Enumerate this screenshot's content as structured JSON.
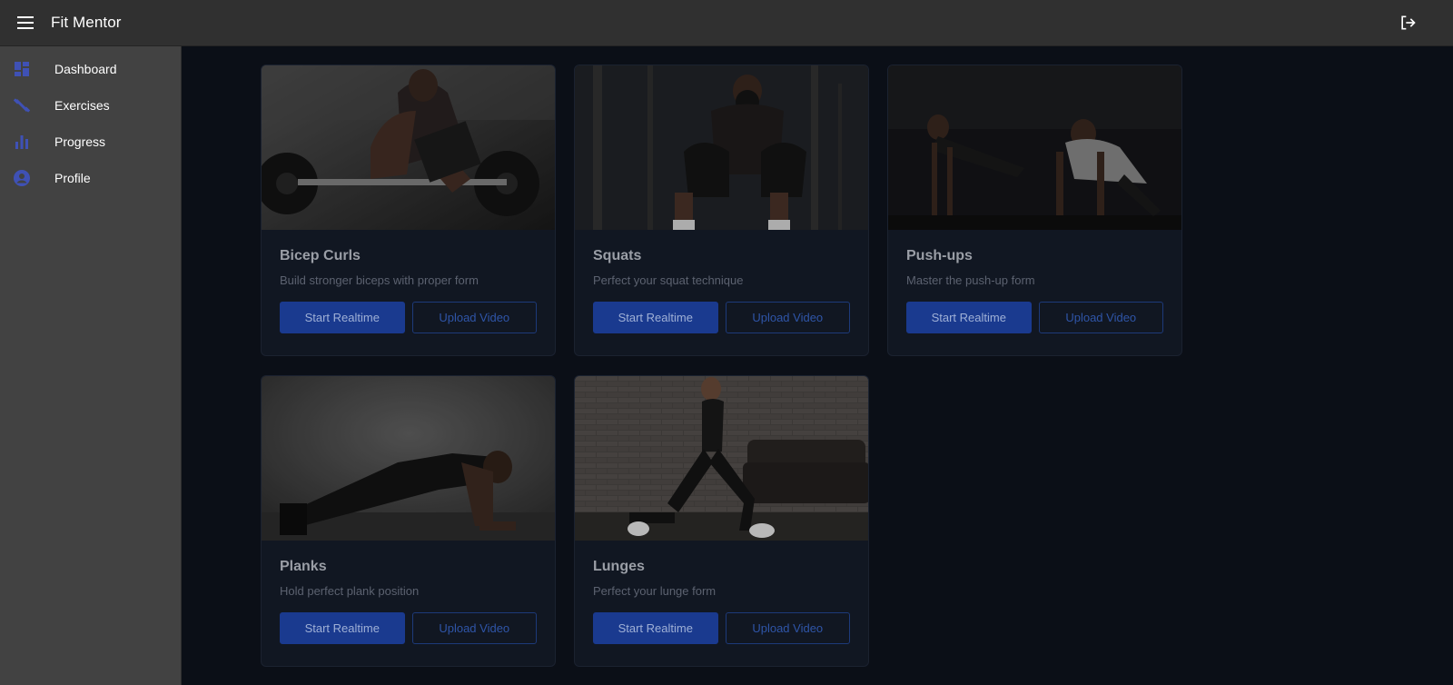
{
  "app": {
    "title": "Fit Mentor"
  },
  "header": {
    "menu_icon": "menu-icon",
    "logout_icon": "logout-icon"
  },
  "sidebar": {
    "accent_color": "#3f51b5",
    "items": [
      {
        "label": "Dashboard",
        "icon": "dashboard-icon"
      },
      {
        "label": "Exercises",
        "icon": "exercises-icon"
      },
      {
        "label": "Progress",
        "icon": "bar-chart-icon"
      },
      {
        "label": "Profile",
        "icon": "account-circle-icon"
      }
    ]
  },
  "exercises": [
    {
      "title": "Bicep Curls",
      "description": "Build stronger biceps with proper form",
      "primary_action": "Start Realtime",
      "secondary_action": "Upload Video"
    },
    {
      "title": "Squats",
      "description": "Perfect your squat technique",
      "primary_action": "Start Realtime",
      "secondary_action": "Upload Video"
    },
    {
      "title": "Push-ups",
      "description": "Master the push-up form",
      "primary_action": "Start Realtime",
      "secondary_action": "Upload Video"
    },
    {
      "title": "Planks",
      "description": "Hold perfect plank position",
      "primary_action": "Start Realtime",
      "secondary_action": "Upload Video"
    },
    {
      "title": "Lunges",
      "description": "Perfect your lunge form",
      "primary_action": "Start Realtime",
      "secondary_action": "Upload Video"
    }
  ],
  "colors": {
    "appbar": "#303030",
    "sidebar": "#424242",
    "background": "#0b0f17",
    "card": "#111722",
    "primary_button": "#1a3a8f"
  }
}
